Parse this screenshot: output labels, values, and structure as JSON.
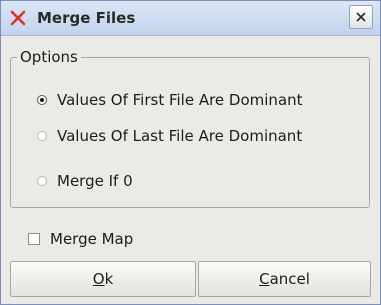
{
  "window": {
    "title": "Merge Files",
    "app_icon": "red-x-icon",
    "close_icon": "close-icon"
  },
  "options": {
    "legend": "Options",
    "items": [
      {
        "label": "Values Of First File Are Dominant",
        "selected": true
      },
      {
        "label": "Values Of Last File Are Dominant",
        "selected": false
      },
      {
        "label": "Merge If 0",
        "selected": false
      }
    ]
  },
  "merge_map": {
    "label": "Merge Map",
    "checked": false
  },
  "buttons": {
    "ok": {
      "mnemonic": "O",
      "rest": "k"
    },
    "cancel": {
      "mnemonic": "C",
      "rest": "ancel"
    }
  },
  "colors": {
    "accent_icon": "#d8332a",
    "titlebar": "#c8d8ee"
  }
}
